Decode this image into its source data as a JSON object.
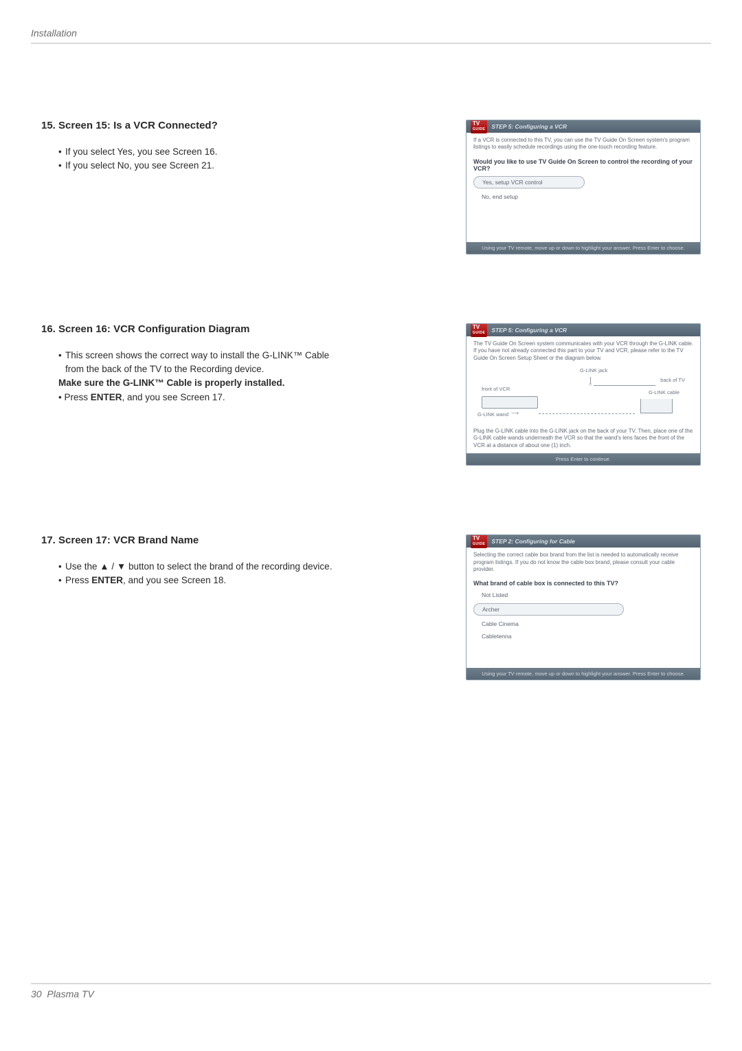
{
  "header": {
    "title": "Installation"
  },
  "footer": {
    "page_number": "30",
    "product": "Plasma TV"
  },
  "logo": {
    "line1": "TV",
    "line2": "GUIDE"
  },
  "sections": [
    {
      "heading": "15. Screen 15: Is a VCR Connected?",
      "bullets": [
        {
          "text": "If you select Yes, you see Screen 16."
        },
        {
          "text": "If you select No, you see Screen 21."
        }
      ],
      "panel": {
        "title": "STEP 5: Configuring a VCR",
        "desc": "If a VCR is connected to this TV, you can use the TV Guide On Screen system's program listings to easily schedule recordings using the one-touch recording feature.",
        "question": "Would you like to use TV Guide On Screen to control the recording of your VCR?",
        "options": [
          {
            "label": "Yes, setup VCR control",
            "selected": true
          },
          {
            "label": "No, end setup",
            "selected": false
          }
        ],
        "foot": "Using your TV remote, move up or down to highlight your answer. Press Enter to choose."
      }
    },
    {
      "heading": "16. Screen 16: VCR Configuration Diagram",
      "lines": [
        {
          "html": "This screen shows the correct way to install the G-LINK™ Cable from the back of the TV to the Recording device."
        },
        {
          "html": "<strong>Make sure the G-LINK™ Cable is properly installed.</strong>"
        },
        {
          "html": "Press <strong>ENTER</strong>, and you see Screen 17."
        }
      ],
      "panel": {
        "title": "STEP 5: Configuring a VCR",
        "desc": "The TV Guide On Screen system communicates with your VCR through the G-LINK cable. If you have not already connected this part to your TV and VCR, please refer to the TV Guide On Screen Setup Sheet or the diagram below.",
        "diagram": {
          "labels": {
            "front_vcr": "front of VCR",
            "glink_jack": "G-LINK jack",
            "back_tv": "back of TV",
            "glink_cable": "G-LINK cable",
            "glink_wand": "G-LINK wand"
          }
        },
        "desc2": "Plug the G-LINK cable into the G-LINK jack on the back of your TV. Then, place one of the G-LINK cable wands underneath the VCR so that the wand's lens faces the front of the VCR at a distance of about one (1) inch.",
        "foot": "Press Enter to continue."
      }
    },
    {
      "heading": "17. Screen 17: VCR Brand Name",
      "lines": [
        {
          "html": "Use the ▲ / ▼ button to select the brand of the recording device."
        },
        {
          "html": "Press <strong>ENTER</strong>, and you see Screen 18."
        }
      ],
      "panel": {
        "title": "STEP 2: Configuring for Cable",
        "desc": "Selecting the correct cable box brand from the list is needed to automatically receive program listings. If you do not know the cable box brand, please consult your cable provider.",
        "question": "What brand of cable box is connected to this TV?",
        "options": [
          {
            "label": "Not Listed",
            "selected": false
          },
          {
            "label": "Archer",
            "selected": true
          },
          {
            "label": "Cable Cinema",
            "selected": false
          },
          {
            "label": "Cabletenna",
            "selected": false
          }
        ],
        "foot": "Using your TV remote, move up or down to highlight your answer. Press Enter to choose."
      }
    }
  ]
}
